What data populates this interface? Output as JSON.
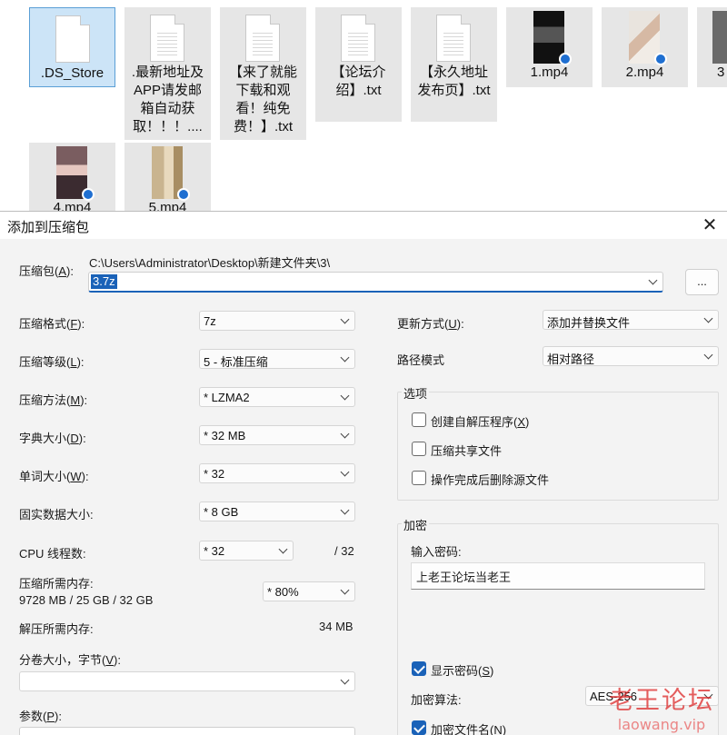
{
  "explorer": {
    "files": [
      {
        "name": ".DS_Store",
        "type": "doc",
        "selected": true
      },
      {
        "name": ".最新地址及APP请发邮箱自动获取！！！....",
        "type": "doc"
      },
      {
        "name": "【来了就能下载和观看！纯免费！】.txt",
        "type": "doc"
      },
      {
        "name": "【论坛介绍】.txt",
        "type": "doc"
      },
      {
        "name": "【永久地址发布页】.txt",
        "type": "doc"
      },
      {
        "name": "1.mp4",
        "type": "video"
      },
      {
        "name": "2.mp4",
        "type": "video"
      },
      {
        "name": "3",
        "type": "video"
      },
      {
        "name": "4.mp4",
        "type": "video"
      },
      {
        "name": "5.mp4",
        "type": "video"
      }
    ]
  },
  "dialog": {
    "title": "添加到压缩包",
    "close_glyph": "✕",
    "archive": {
      "label": "压缩包(",
      "key": "A",
      "label_end": "):",
      "path": "C:\\Users\\Administrator\\Desktop\\新建文件夹\\3\\",
      "filename": "3.7z",
      "browse_label": "..."
    },
    "left": {
      "format": {
        "label": "压缩格式(",
        "key": "F",
        "end": "):",
        "value": "7z"
      },
      "level": {
        "label": "压缩等级(",
        "key": "L",
        "end": "):",
        "value": "5 - 标准压缩"
      },
      "method": {
        "label": "压缩方法(",
        "key": "M",
        "end": "):",
        "value": "*  LZMA2"
      },
      "dict": {
        "label": "字典大小(",
        "key": "D",
        "end": "):",
        "value": "*  32 MB"
      },
      "word": {
        "label": "单词大小(",
        "key": "W",
        "end": "):",
        "value": "*  32"
      },
      "solid": {
        "label": "固实数据大小:",
        "value": "*  8 GB"
      },
      "cpu": {
        "label": "CPU 线程数:",
        "value": "*  32",
        "max": "/ 32"
      },
      "mem_comp": {
        "label": "压缩所需内存:",
        "detail": "9728 MB / 25 GB / 32 GB",
        "value": "*  80%"
      },
      "mem_decomp": {
        "label": "解压所需内存:",
        "value": "34 MB"
      },
      "volume": {
        "label": "分卷大小，字节(",
        "key": "V",
        "end": "):",
        "value": ""
      },
      "params": {
        "label": "参数(",
        "key": "P",
        "end": "):"
      }
    },
    "right": {
      "update": {
        "label": "更新方式(",
        "key": "U",
        "end": "):",
        "value": "添加并替换文件"
      },
      "pathmode": {
        "label": "路径模式",
        "value": "相对路径"
      },
      "options": {
        "title": "选项",
        "sfx": {
          "label": "创建自解压程序(",
          "key": "X",
          "end": ")",
          "checked": false
        },
        "shared": {
          "label": "压缩共享文件",
          "checked": false
        },
        "delete": {
          "label": "操作完成后删除源文件",
          "checked": false
        }
      },
      "encryption": {
        "title": "加密",
        "enter_label": "输入密码:",
        "password": "上老王论坛当老王",
        "show": {
          "label": "显示密码(",
          "key": "S",
          "end": ")",
          "checked": true
        },
        "method_label": "加密算法:",
        "method_value": "AES-256",
        "names": {
          "label": "加密文件名(",
          "key": "N",
          "end": ")",
          "checked": true
        }
      }
    }
  },
  "watermark": {
    "line1": "老王论坛",
    "line2": "laowang.vip"
  }
}
